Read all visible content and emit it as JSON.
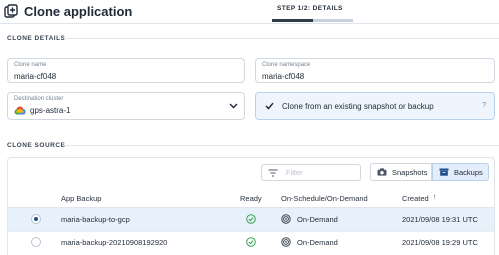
{
  "header": {
    "title": "Clone application",
    "step": "STEP 1/2: DETAILS",
    "progress_fraction": 0.5
  },
  "clone_details": {
    "section_label": "CLONE DETAILS",
    "clone_name": {
      "label": "Clone name",
      "value": "maria-cf048"
    },
    "clone_namespace": {
      "label": "Clone namespace",
      "value": "maria-cf048"
    },
    "destination_cluster": {
      "label": "Destination cluster",
      "value": "gps-astra-1",
      "icon": "gcp-cloud-icon"
    },
    "snapshot_option": {
      "label": "Clone from an existing snapshot or backup",
      "checked": true,
      "help": "?"
    }
  },
  "clone_source": {
    "section_label": "CLONE SOURCE",
    "filter_placeholder": "Filter",
    "toggle": {
      "snapshots": "Snapshots",
      "backups": "Backups",
      "active": "backups"
    },
    "columns": {
      "backup": "App Backup",
      "ready": "Ready",
      "schedule": "On-Schedule/On-Demand",
      "created": "Created"
    },
    "sort_indicator": "↑",
    "rows": [
      {
        "name": "maria-backup-to-gcp",
        "ready": true,
        "schedule": "On-Demand",
        "created": "2021/09/08 19:31 UTC",
        "selected": true
      },
      {
        "name": "maria-backup-20210908192920",
        "ready": true,
        "schedule": "On-Demand",
        "created": "2021/09/08 19:29 UTC",
        "selected": false
      }
    ]
  },
  "colors": {
    "accent": "#1f4e8c",
    "selected_row": "#e7f1fb",
    "ready_green": "#3aa352"
  }
}
